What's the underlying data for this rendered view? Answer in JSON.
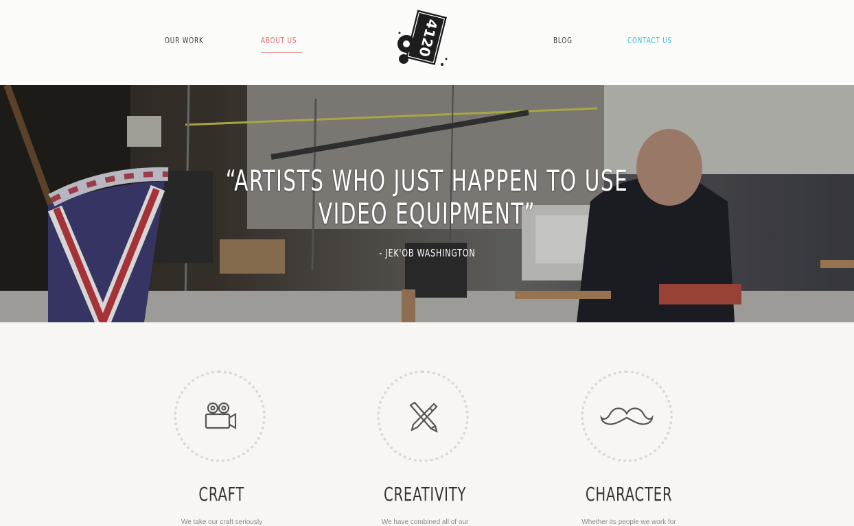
{
  "nav": {
    "our_work": "OUR WORK",
    "about_us": "ABOUT US",
    "blog": "BLOG",
    "contact_us": "CONTACT US"
  },
  "logo": {
    "text": "4120",
    "icon": "camera-logo"
  },
  "hero": {
    "quote_line1": "“ARTISTS WHO JUST HAPPEN TO USE",
    "quote_line2": "VIDEO EQUIPMENT”",
    "attribution": "- JEK'OB WASHINGTON"
  },
  "features": [
    {
      "title": "CRAFT",
      "icon": "video-camera-icon",
      "description": "We take our craft seriously"
    },
    {
      "title": "CREATIVITY",
      "icon": "pencil-brush-icon",
      "description": "We have combined all of our"
    },
    {
      "title": "CHARACTER",
      "icon": "mustache-icon",
      "description": "Whether its people we work for"
    }
  ],
  "colors": {
    "active_nav": "#e06868",
    "contact_nav": "#3fb9d3",
    "background": "#f7f6f2"
  }
}
